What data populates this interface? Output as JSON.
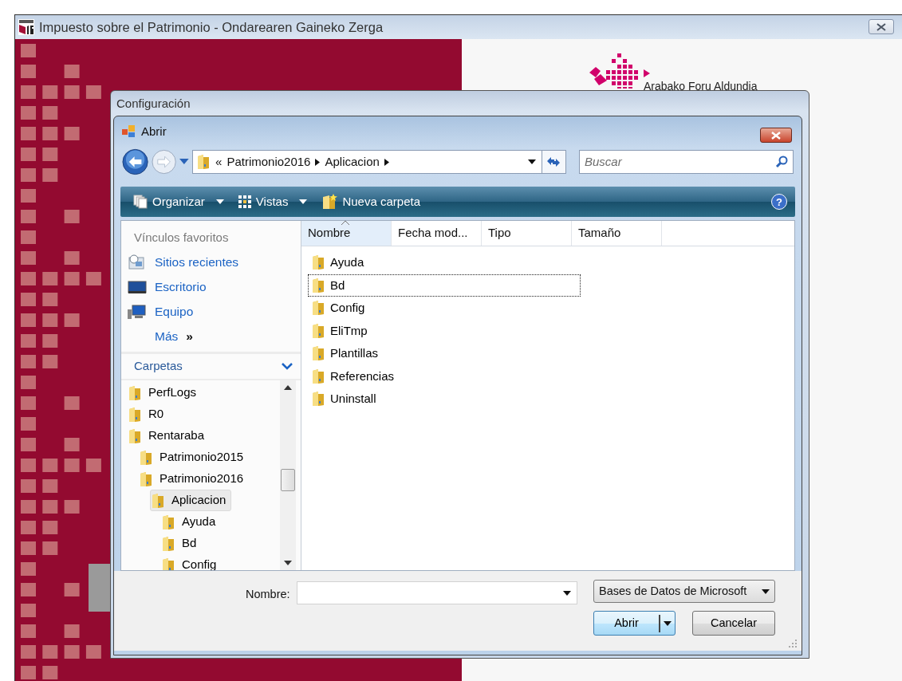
{
  "app_window": {
    "title": "Impuesto sobre el Patrimonio - Ondarearen Gaineko Zerga",
    "logo_text": "Arabako Foru Aldundia"
  },
  "config_window": {
    "title": "Configuración"
  },
  "open_dialog": {
    "title": "Abrir",
    "breadcrumb": {
      "overflow": "«",
      "parts": [
        "Patrimonio2016",
        "Aplicacion"
      ]
    },
    "search": {
      "placeholder": "Buscar"
    },
    "help_glyph": "?",
    "toolbar": [
      {
        "label": "Organizar",
        "kind": "menu"
      },
      {
        "label": "Vistas",
        "kind": "menu"
      },
      {
        "label": "Nueva carpeta",
        "kind": "action"
      }
    ],
    "favorites": {
      "header": "Vínculos favoritos",
      "items": [
        {
          "label": "Sitios recientes",
          "kind": "recent"
        },
        {
          "label": "Escritorio",
          "kind": "desktop"
        },
        {
          "label": "Equipo",
          "kind": "computer"
        }
      ],
      "more": "Más",
      "more_glyph": "»"
    },
    "folders": {
      "header": "Carpetas",
      "tree": [
        {
          "label": "PerfLogs",
          "selected": false
        },
        {
          "label": "R0",
          "selected": false
        },
        {
          "label": "Rentaraba",
          "selected": false,
          "children": [
            {
              "label": "Patrimonio2015",
              "selected": false
            },
            {
              "label": "Patrimonio2016",
              "selected": false,
              "children": [
                {
                  "label": "Aplicacion",
                  "selected": true,
                  "children": [
                    {
                      "label": "Ayuda",
                      "selected": false
                    },
                    {
                      "label": "Bd",
                      "selected": false
                    },
                    {
                      "label": "Config",
                      "selected": false
                    }
                  ]
                }
              ]
            }
          ]
        }
      ]
    },
    "columns": [
      {
        "label": "Nombre",
        "sorted": true
      },
      {
        "label": "Fecha mod...",
        "sorted": false
      },
      {
        "label": "Tipo",
        "sorted": false
      },
      {
        "label": "Tamaño",
        "sorted": false
      }
    ],
    "files": [
      {
        "name": "Ayuda",
        "focused": false
      },
      {
        "name": "Bd",
        "focused": true
      },
      {
        "name": "Config",
        "focused": false
      },
      {
        "name": "EliTmp",
        "focused": false
      },
      {
        "name": "Plantillas",
        "focused": false
      },
      {
        "name": "Referencias",
        "focused": false
      },
      {
        "name": "Uninstall",
        "focused": false
      }
    ],
    "filename_label": "Nombre:",
    "file_type": "Bases de Datos de Microsoft",
    "buttons": [
      {
        "label": "Abrir",
        "kind": "split"
      },
      {
        "label": "Cancelar",
        "kind": "plain"
      }
    ]
  }
}
